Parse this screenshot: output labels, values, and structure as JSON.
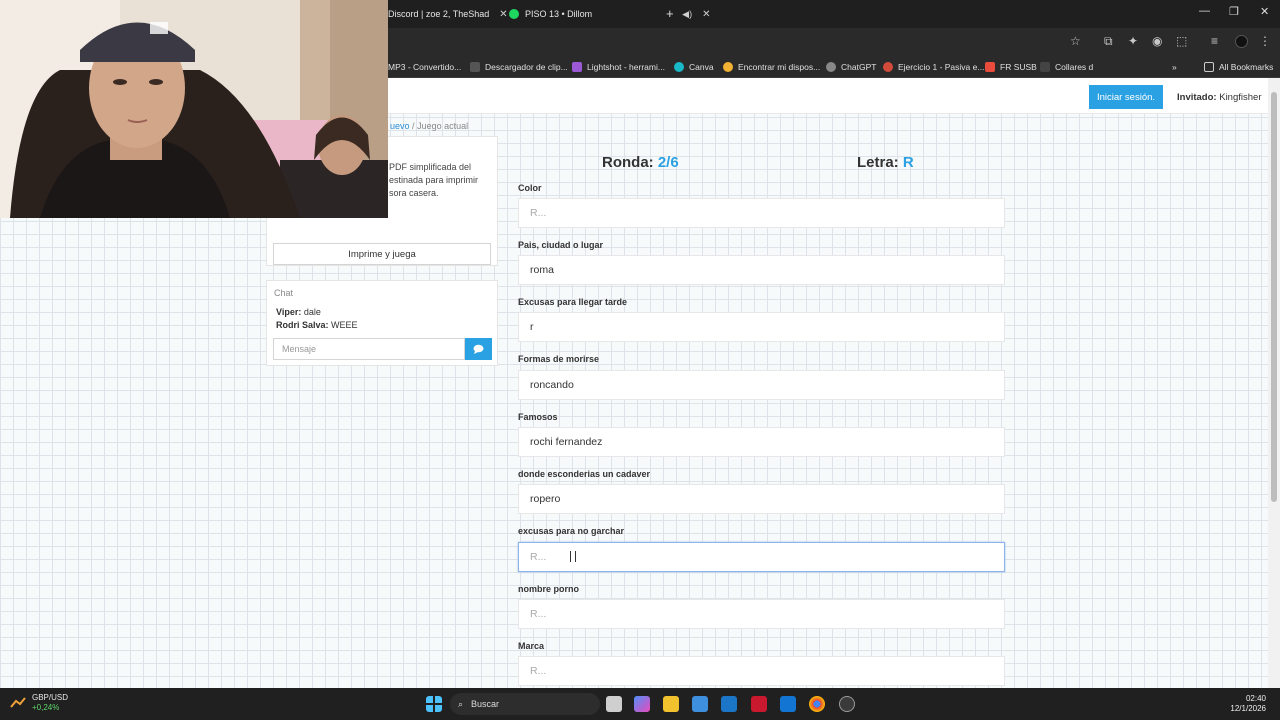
{
  "browser": {
    "tabs": [
      {
        "label": "Discord | zoe 2, TheShad"
      },
      {
        "label": "PISO 13 • Dillom"
      }
    ],
    "new_tab": "+",
    "window_controls": {
      "minimize": "—",
      "restore": "❐",
      "close": "✕"
    },
    "bookmarks": [
      "MP3 - Convertido...",
      "Descargador de clip...",
      "Lightshot - herrami...",
      "Canva",
      "Encontrar mi dispos...",
      "ChatGPT",
      "Ejercicio 1 - Pasiva e...",
      "FR SUSB",
      "Collares d",
      "All Bookmarks"
    ],
    "overflow": "»"
  },
  "header": {
    "login_label": "Iniciar sesión.",
    "guest_prefix": "Invitado:",
    "guest_name": "Kingfisher"
  },
  "breadcrumb": {
    "prev": "uevo",
    "sep": "/",
    "current": "Juego actual"
  },
  "sidebar": {
    "pdf_text": "PDF simplificada del estinada para imprimir sora casera.",
    "print_button": "Imprime y juega",
    "chat": {
      "title": "Chat",
      "messages": [
        {
          "author": "Viper:",
          "text": "dale"
        },
        {
          "author": "Rodri Salva:",
          "text": "WEEE"
        }
      ],
      "input_placeholder": "Mensaje"
    }
  },
  "game": {
    "round_label": "Ronda:",
    "round_value": "2/6",
    "letter_label": "Letra:",
    "letter_value": "R",
    "fields": [
      {
        "label": "Color",
        "value": "",
        "placeholder": "R..."
      },
      {
        "label": "Pais, ciudad o lugar",
        "value": "roma",
        "placeholder": "R..."
      },
      {
        "label": "Excusas para llegar tarde",
        "value": "r",
        "placeholder": "R..."
      },
      {
        "label": "Formas de morirse",
        "value": "roncando",
        "placeholder": "R..."
      },
      {
        "label": "Famosos",
        "value": "rochi fernandez",
        "placeholder": "R..."
      },
      {
        "label": "donde esconderias un cadaver",
        "value": "ropero",
        "placeholder": "R..."
      },
      {
        "label": "excusas para no garchar",
        "value": "",
        "placeholder": "R..."
      },
      {
        "label": "nombre porno",
        "value": "",
        "placeholder": "R..."
      },
      {
        "label": "Marca",
        "value": "",
        "placeholder": "R..."
      }
    ]
  },
  "taskbar": {
    "widget_title": "GBP/USD",
    "widget_change": "+0,24%",
    "search_label": "Buscar",
    "time": "02:40",
    "date": "12/1/2026"
  },
  "colors": {
    "accent": "#2aa1e3",
    "chrome_dark": "#1f1f1f",
    "spotify": "#1ed760"
  }
}
